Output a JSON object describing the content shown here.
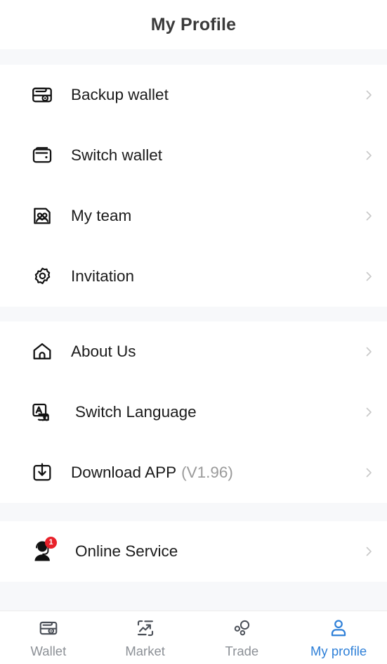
{
  "header": {
    "title": "My Profile"
  },
  "colors": {
    "accent": "#2f80d8",
    "badge": "#e8212a",
    "band": "#f7f8fa",
    "text": "#1b1b1b",
    "muted": "#9a9a9a",
    "tab_inactive": "#8c9096"
  },
  "groups": [
    {
      "name": "wallet-group",
      "items": [
        {
          "icon": "backup-wallet-icon",
          "label": "Backup wallet",
          "chevron": "chevron-right-icon"
        },
        {
          "icon": "switch-wallet-icon",
          "label": "Switch wallet",
          "chevron": "chevron-right-icon"
        },
        {
          "icon": "my-team-icon",
          "label": "My team",
          "chevron": "chevron-right-icon"
        },
        {
          "icon": "invitation-gear-icon",
          "label": "Invitation",
          "chevron": "chevron-right-icon"
        }
      ]
    },
    {
      "name": "info-group",
      "items": [
        {
          "icon": "home-icon",
          "label": "About Us",
          "chevron": "chevron-right-icon"
        },
        {
          "icon": "translate-icon",
          "label": "Switch Language",
          "chevron": "chevron-right-icon"
        },
        {
          "icon": "download-icon",
          "label": "Download APP",
          "version": "(V1.96)",
          "chevron": "chevron-right-icon"
        }
      ]
    },
    {
      "name": "service-group",
      "items": [
        {
          "icon": "support-agent-icon",
          "label": "Online Service",
          "badge": "1",
          "chevron": "chevron-right-icon"
        }
      ]
    }
  ],
  "tabbar": {
    "tabs": [
      {
        "icon": "wallet-icon",
        "label": "Wallet",
        "active": false
      },
      {
        "icon": "market-icon",
        "label": "Market",
        "active": false
      },
      {
        "icon": "trade-icon",
        "label": "Trade",
        "active": false
      },
      {
        "icon": "profile-icon",
        "label": "My profile",
        "active": true
      }
    ]
  }
}
